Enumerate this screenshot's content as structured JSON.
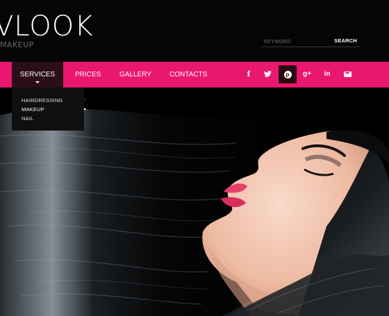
{
  "brand": {
    "logo_text": "VLOOK",
    "tagline": "MAKEUP"
  },
  "search": {
    "placeholder": "KEYWORD",
    "button_label": "SEARCH"
  },
  "nav": {
    "items": [
      {
        "label": "SERVICES",
        "active": true
      },
      {
        "label": "PRICES"
      },
      {
        "label": "GALLERY"
      },
      {
        "label": "CONTACTS"
      }
    ],
    "dropdown": [
      {
        "label": "HAIRDRESSING",
        "has_submenu": true
      },
      {
        "label": "MAKEUP",
        "has_submenu": true
      },
      {
        "label": "NAIL",
        "has_submenu": false
      }
    ]
  },
  "social": [
    {
      "icon": "facebook-icon",
      "glyph": "f"
    },
    {
      "icon": "twitter-icon",
      "glyph": "🐦"
    },
    {
      "icon": "pinterest-icon",
      "glyph": "℗",
      "active": true
    },
    {
      "icon": "google-plus-icon",
      "glyph": "g+"
    },
    {
      "icon": "linkedin-icon",
      "glyph": "in"
    },
    {
      "icon": "envelope-icon",
      "glyph": "✉"
    }
  ],
  "colors": {
    "accent": "#ea1770",
    "header_bg": "#050505",
    "active_nav_bg": "#2b0e19",
    "dropdown_bg": "#0f0f0f"
  }
}
